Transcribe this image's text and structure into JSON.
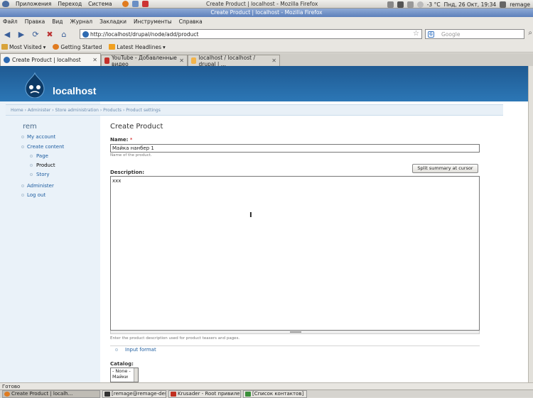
{
  "top_panel": {
    "menus": [
      "Приложения",
      "Переход",
      "Система"
    ],
    "window_title": "Create Product | localhost - Mozilla Firefox",
    "temperature": "-3 °C",
    "datetime": "Пнд, 26 Окт, 19:34",
    "user": "remage"
  },
  "browser": {
    "menubar": [
      "Файл",
      "Правка",
      "Вид",
      "Журнал",
      "Закладки",
      "Инструменты",
      "Справка"
    ],
    "url": "http://localhost/drupal/node/add/product",
    "search_placeholder": "Google",
    "bookmarks": [
      "Most Visited",
      "Getting Started",
      "Latest Headlines"
    ],
    "tabs": [
      {
        "label": "Create Product | localhost",
        "active": true
      },
      {
        "label": "YouTube - Добавленные видео",
        "active": false
      },
      {
        "label": "localhost / localhost / drupal | ...",
        "active": false
      }
    ],
    "status": "Готово"
  },
  "site": {
    "name": "localhost",
    "breadcrumb": "Home › Administer › Store administration › Products › Product settings"
  },
  "sidebar": {
    "title": "rem",
    "links": {
      "my_account": "My account",
      "create_content": "Create content",
      "page": "Page",
      "product": "Product",
      "story": "Story",
      "administer": "Administer",
      "log_out": "Log out"
    }
  },
  "form": {
    "title": "Create Product",
    "name_label": "Name:",
    "required_mark": "*",
    "name_value": "Майка нанбер 1",
    "name_help": "Name of the product.",
    "split_button": "Split summary at cursor",
    "description_label": "Description:",
    "description_value": "xxx",
    "description_help": "Enter the product description used for product teasers and pages.",
    "input_format": "Input format",
    "catalog_label": "Catalog:",
    "catalog_options": [
      "- None -",
      "Майки"
    ]
  },
  "taskbar": [
    {
      "label": "Create Product | localh...",
      "active": true
    },
    {
      "label": "[remage@remage-deskto...",
      "active": false
    },
    {
      "label": "Krusader - Root привиле...",
      "active": false
    },
    {
      "label": "[Список контактов]",
      "active": false
    }
  ],
  "colors": {
    "header_blue": "#2c77b6",
    "sidebar_bg": "#eaf2f9",
    "link": "#1b5b9f",
    "title_bar": "#5d80bb"
  }
}
